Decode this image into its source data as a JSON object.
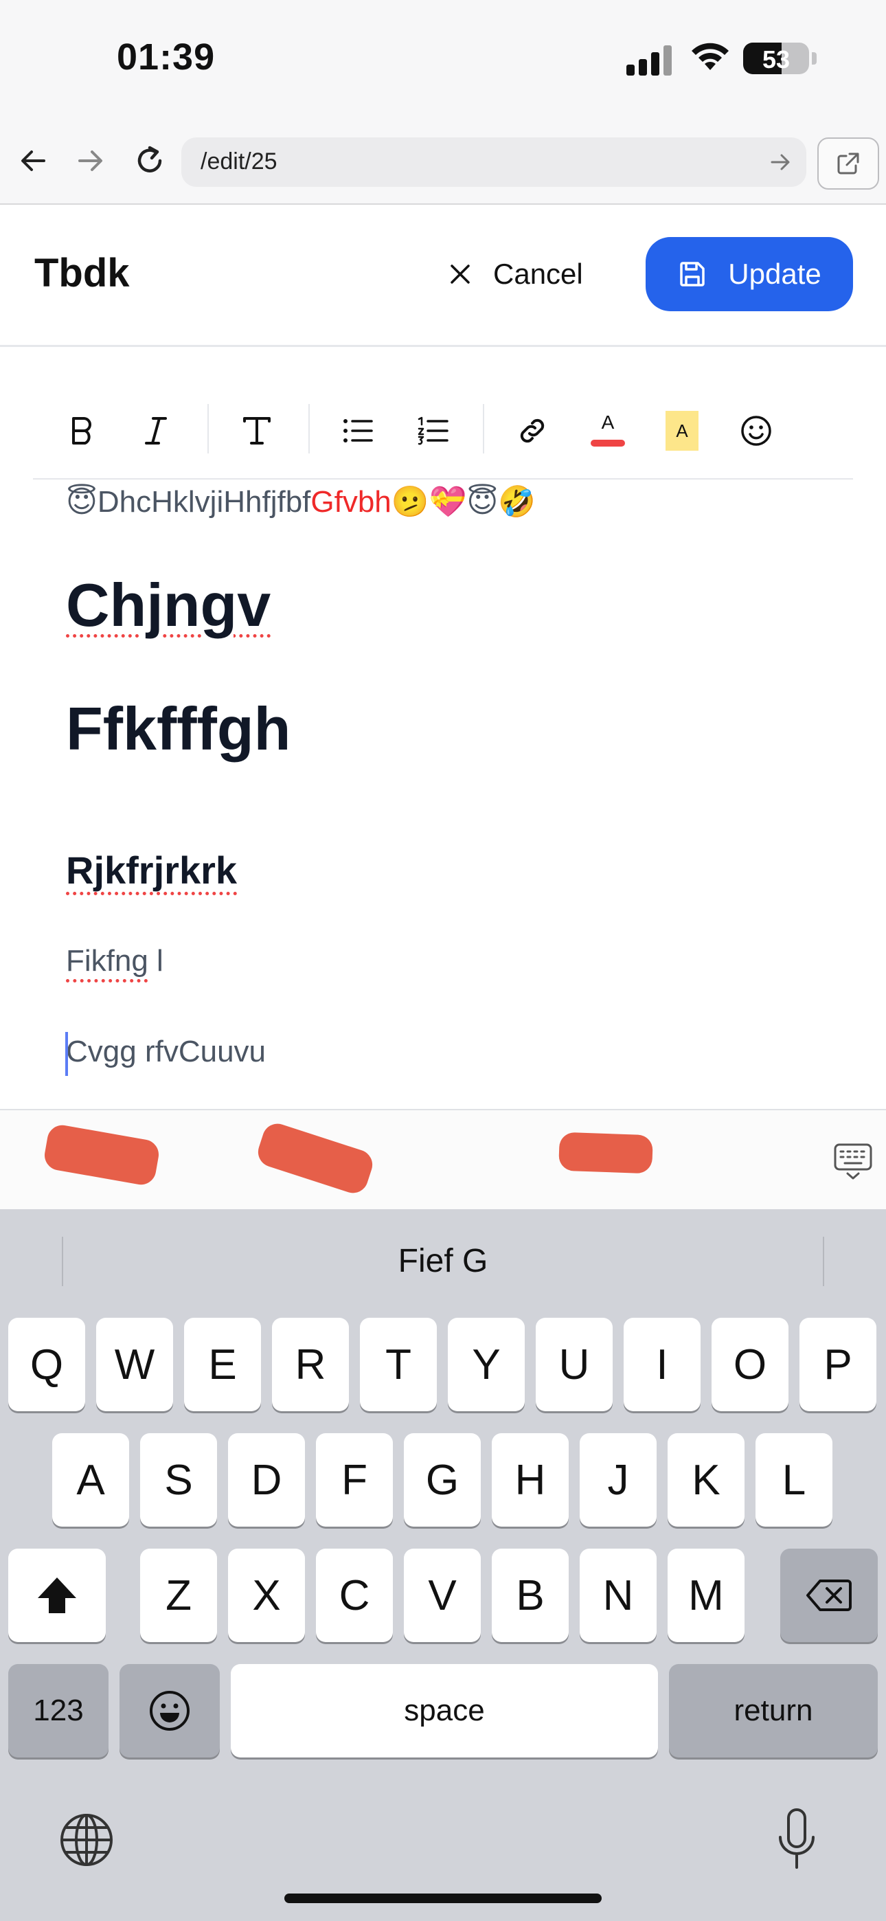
{
  "status": {
    "time": "01:39",
    "battery": "53"
  },
  "browser": {
    "url": "/edit/25"
  },
  "header": {
    "title": "Tbdk",
    "cancel_label": "Cancel",
    "update_label": "Update"
  },
  "toolbar": {
    "text_color": "#ef4444",
    "highlight_color": "#fde68a",
    "font_color_letter": "A",
    "highlight_letter": "A"
  },
  "editor": {
    "line1_emoji_a": "😇",
    "line1_text_a": "DhcHklvjiHhfjfbf",
    "line1_text_red": "Gfvbh",
    "line1_emoji_b": "🫤💝😇🤣",
    "heading1": "Chjngv",
    "heading2": "Ffkfffgh",
    "heading3": "Rjkfrjrkrk",
    "para1_a": "Fikfng",
    "para1_b": " l",
    "para2": "Cvgg rfvCuuvu"
  },
  "keyboard": {
    "suggestion": "Fief G",
    "row1": [
      "Q",
      "W",
      "E",
      "R",
      "T",
      "Y",
      "U",
      "I",
      "O",
      "P"
    ],
    "row2": [
      "A",
      "S",
      "D",
      "F",
      "G",
      "H",
      "J",
      "K",
      "L"
    ],
    "row3": [
      "Z",
      "X",
      "C",
      "V",
      "B",
      "N",
      "M"
    ],
    "numbers_label": "123",
    "space_label": "space",
    "return_label": "return"
  }
}
